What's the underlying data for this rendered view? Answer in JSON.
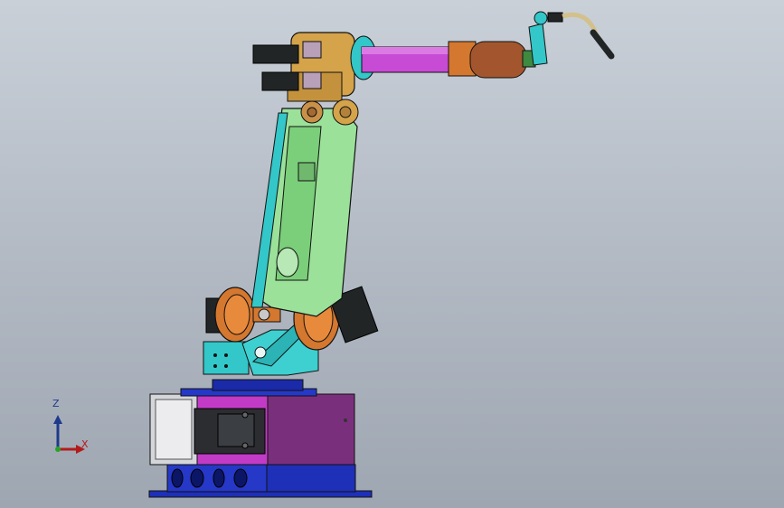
{
  "viewport": {
    "background_top": "#c9d0d8",
    "background_bottom": "#9ea6b1"
  },
  "triad": {
    "z_label": "Z",
    "x_label": "X",
    "z_color": "#1f3a8c",
    "x_color": "#b31b1b"
  },
  "model": {
    "colors": {
      "base_blue": "#1e2fb8",
      "base_purple": "#7a2f7d",
      "base_magenta": "#c23bc6",
      "link_green": "#9ce19a",
      "link_cyan": "#33c7c9",
      "joint_orange": "#d4772f",
      "wrist_gold": "#d4a34a",
      "arm_magenta": "#c74bd4",
      "motor_dark": "#222526",
      "tool_brown": "#a3562d",
      "torch_tan": "#d2c18a"
    }
  }
}
